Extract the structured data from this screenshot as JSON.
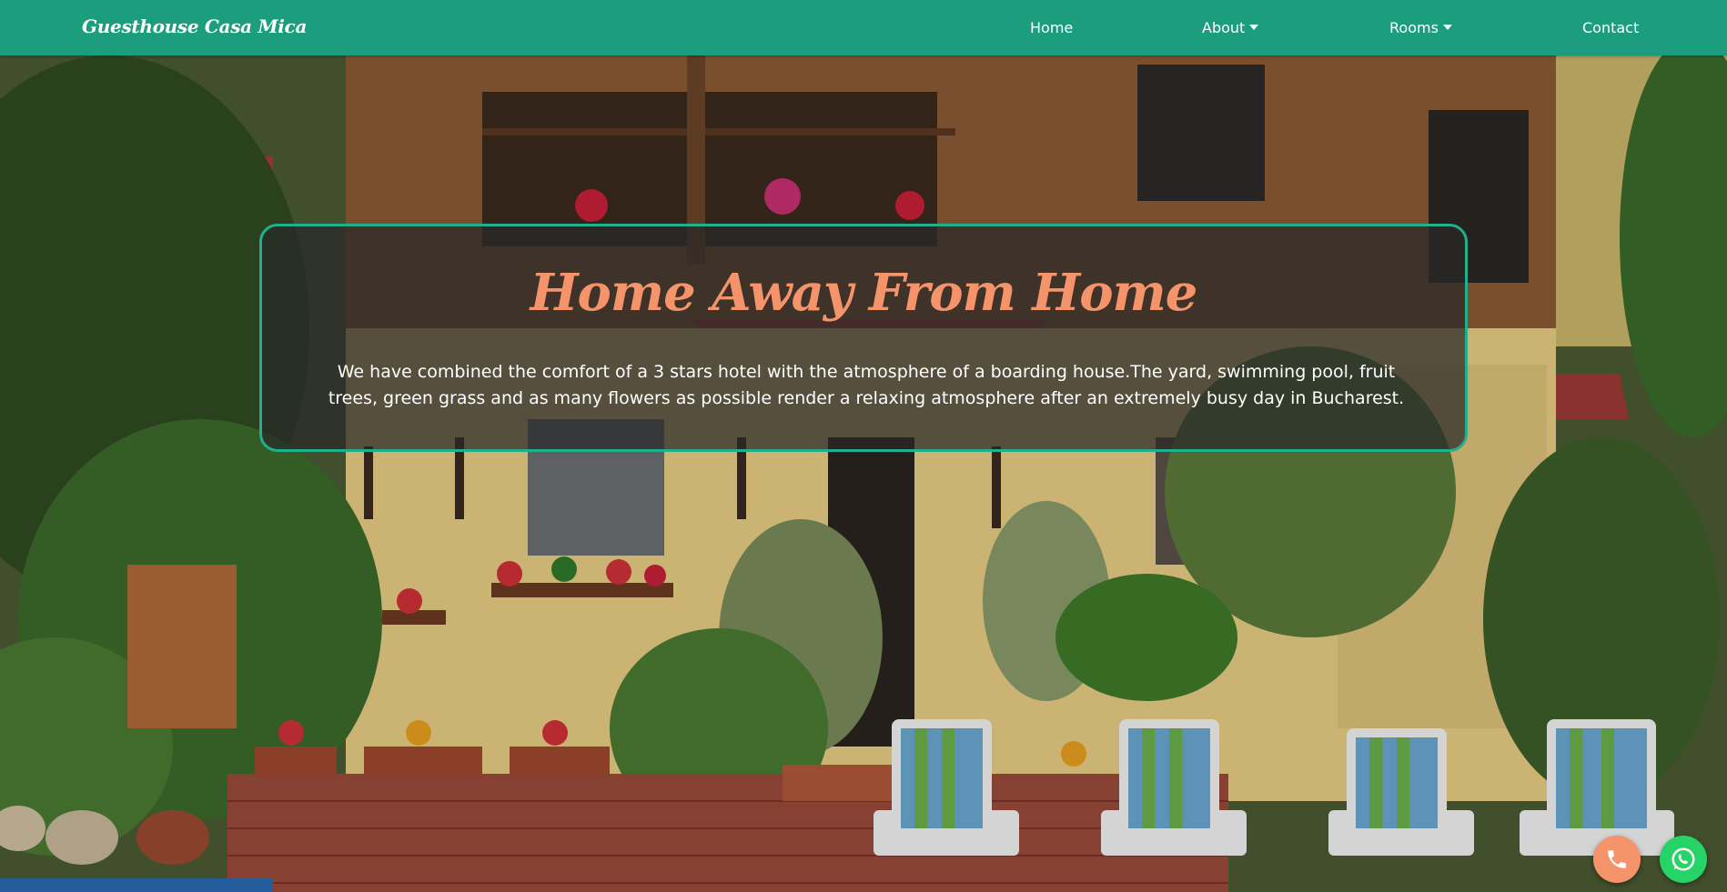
{
  "navbar": {
    "brand": "Guesthouse Casa Mica",
    "items": [
      {
        "label": "Home",
        "dropdown": false
      },
      {
        "label": "About",
        "dropdown": true
      },
      {
        "label": "Rooms",
        "dropdown": true
      },
      {
        "label": "Contact",
        "dropdown": false
      }
    ]
  },
  "hero": {
    "title": "Home Away From Home",
    "text": "We have combined the comfort of a 3 stars hotel with the atmosphere of a boarding house.The yard, swimming pool, fruit trees, green grass and as many flowers as possible render a relaxing atmosphere after an extremely busy day in Bucharest."
  },
  "floating_buttons": [
    {
      "name": "phone-icon"
    },
    {
      "name": "whatsapp-icon"
    }
  ],
  "colors": {
    "navbar": "#1c9e7e",
    "title": "#f5936b",
    "card_border": "#21b08c",
    "phone_button": "#f5936b",
    "whatsapp_button": "#25d366"
  }
}
